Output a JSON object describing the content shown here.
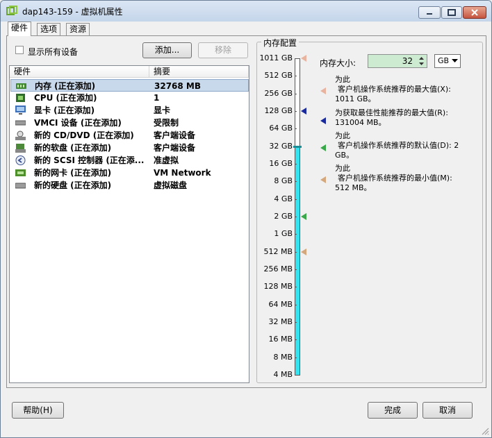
{
  "window": {
    "title": "dap143-159 - 虚拟机属性"
  },
  "tabs": [
    {
      "label": "硬件"
    },
    {
      "label": "选项"
    },
    {
      "label": "资源"
    }
  ],
  "hardware": {
    "show_all_label": "显示所有设备",
    "show_all_checked": false,
    "add_label": "添加...",
    "remove_label": "移除",
    "columns": [
      "硬件",
      "摘要"
    ],
    "rows": [
      {
        "name": "内存 (正在添加)",
        "summary": "32768 MB",
        "icon": "memory-icon",
        "selected": true
      },
      {
        "name": "CPU (正在添加)",
        "summary": "1",
        "icon": "cpu-icon"
      },
      {
        "name": "显卡 (正在添加)",
        "summary": "显卡",
        "icon": "display-card-icon"
      },
      {
        "name": "VMCI 设备 (正在添加)",
        "summary": "受限制",
        "icon": "vmci-device-icon"
      },
      {
        "name": "新的 CD/DVD (正在添加)",
        "summary": "客户端设备",
        "icon": "cd-dvd-icon"
      },
      {
        "name": "新的软盘 (正在添加)",
        "summary": "客户端设备",
        "icon": "floppy-icon"
      },
      {
        "name": "新的 SCSI 控制器 (正在添...",
        "summary": "准虚拟",
        "icon": "scsi-controller-icon"
      },
      {
        "name": "新的网卡 (正在添加)",
        "summary": "VM Network",
        "icon": "network-card-icon"
      },
      {
        "name": "新的硬盘 (正在添加)",
        "summary": "虚拟磁盘",
        "icon": "hard-disk-icon"
      }
    ]
  },
  "memory": {
    "group_label": "内存配置",
    "size_label": "内存大小:",
    "size_value": "32",
    "unit": "GB",
    "scale_labels": [
      "1011 GB",
      "512 GB",
      "256 GB",
      "128 GB",
      "64 GB",
      "32 GB",
      "16 GB",
      "8 GB",
      "4 GB",
      "2 GB",
      "1 GB",
      "512 MB",
      "256 MB",
      "128 MB",
      "64 MB",
      "32 MB",
      "16 MB",
      "8 MB",
      "4 MB"
    ],
    "current_level_label": "32 GB",
    "markers": [
      {
        "label": "1011 GB",
        "color": "#e8b4a0",
        "text_prefix": "为此",
        "text": "客户机操作系统推荐的最大值(X):",
        "value": "1011 GB。"
      },
      {
        "label": "128 GB",
        "color": "#1a2a9c",
        "text_prefix": "",
        "text": "为获取最佳性能推荐的最大值(R):",
        "value": "131004 MB。"
      },
      {
        "label": "2 GB",
        "color": "#3aa84a",
        "text_prefix": "为此",
        "text": "客户机操作系统推荐的默认值(D): 2",
        "value": "GB。"
      },
      {
        "label": "512 MB",
        "color": "#d4a87c",
        "text_prefix": "为此",
        "text": "客户机操作系统推荐的最小值(M):",
        "value": "512 MB。"
      }
    ],
    "slider_color": "#33e3ef"
  },
  "footer": {
    "help_label": "帮助(H)",
    "finish_label": "完成",
    "cancel_label": "取消"
  }
}
